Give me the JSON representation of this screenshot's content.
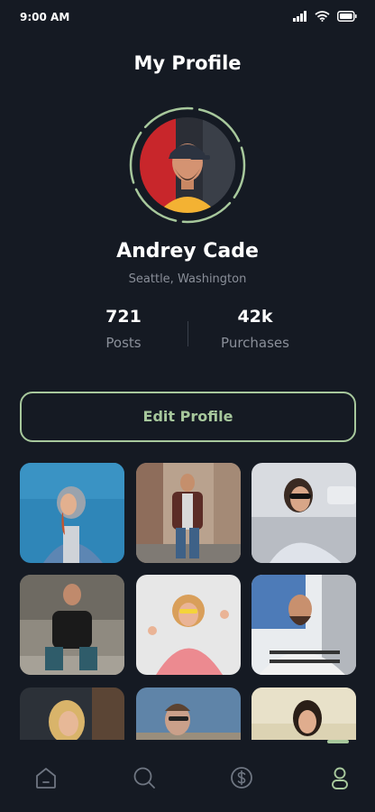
{
  "status_bar": {
    "time": "9:00 AM",
    "icons": [
      "signal-icon",
      "wifi-icon",
      "battery-icon"
    ]
  },
  "header": {
    "title": "My Profile"
  },
  "profile": {
    "name": "Andrey Cade",
    "location": "Seattle, Washington",
    "stats": [
      {
        "value": "721",
        "label": "Posts"
      },
      {
        "value": "42k",
        "label": "Purchases"
      }
    ],
    "edit_button_label": "Edit Profile"
  },
  "gallery": {
    "photo_count": 9
  },
  "bottom_nav": {
    "items": [
      "home-icon",
      "search-icon",
      "dollar-icon",
      "profile-icon"
    ],
    "active": "profile-icon"
  },
  "colors": {
    "background": "#151a23",
    "accent": "#a7c89c",
    "muted_text": "#8a8f99"
  }
}
